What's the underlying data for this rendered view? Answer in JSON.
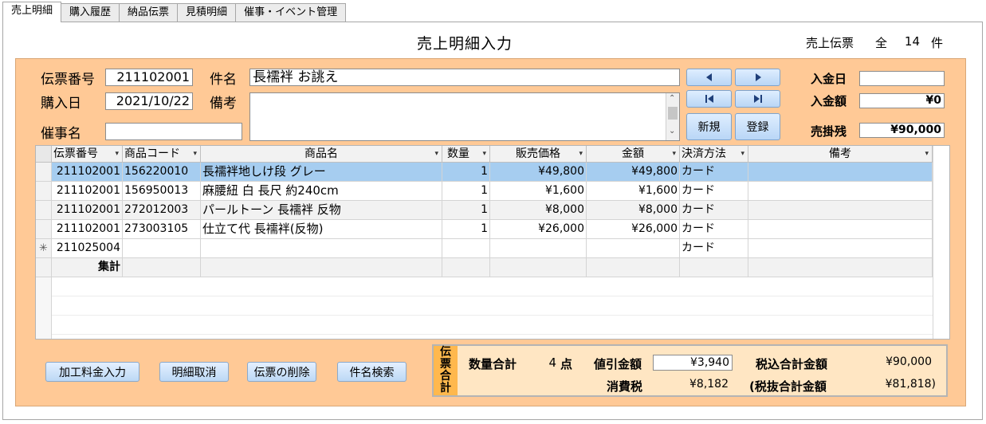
{
  "tabs": [
    "売上明細",
    "購入履歴",
    "納品伝票",
    "見積明細",
    "催事・イベント管理"
  ],
  "title": "売上明細入力",
  "header_total": {
    "label": "売上伝票",
    "scope": "全",
    "count": "14",
    "unit": "件"
  },
  "form": {
    "slip_no_label": "伝票番号",
    "slip_no": "211102001",
    "date_label": "購入日",
    "date": "2021/10/22",
    "event_label": "催事名",
    "event": "",
    "subject_label": "件名",
    "subject": "長襦袢 お誂え",
    "note_label": "備考",
    "note": ""
  },
  "buttons": {
    "new": "新規",
    "register": "登録"
  },
  "payment": {
    "pay_date_label": "入金日",
    "pay_date": "",
    "pay_amount_label": "入金額",
    "pay_amount": "¥0",
    "receivable_label": "売掛残",
    "receivable": "¥90,000"
  },
  "grid": {
    "columns": [
      "伝票番号",
      "商品コード",
      "商品名",
      "数量",
      "販売価格",
      "金額",
      "決済方法",
      "備考"
    ],
    "rows": [
      {
        "slip": "211102001",
        "code": "156220010",
        "name": "長襦袢地しけ段 グレー",
        "qty": "1",
        "price": "¥49,800",
        "amount": "¥49,800",
        "pay": "カード",
        "note": ""
      },
      {
        "slip": "211102001",
        "code": "156950013",
        "name": "麻腰紐 白 長尺 約240cm",
        "qty": "1",
        "price": "¥1,600",
        "amount": "¥1,600",
        "pay": "カード",
        "note": ""
      },
      {
        "slip": "211102001",
        "code": "272012003",
        "name": "パールトーン 長襦袢 反物",
        "qty": "1",
        "price": "¥8,000",
        "amount": "¥8,000",
        "pay": "カード",
        "note": ""
      },
      {
        "slip": "211102001",
        "code": "273003105",
        "name": "仕立て代 長襦袢(反物)",
        "qty": "1",
        "price": "¥26,000",
        "amount": "¥26,000",
        "pay": "カード",
        "note": ""
      }
    ],
    "new_row": {
      "marker": "✳",
      "slip": "211025004",
      "pay": "カード"
    },
    "total_label": "集計"
  },
  "actions": [
    "加工料金入力",
    "明細取消",
    "伝票の削除",
    "件名検索"
  ],
  "summary": {
    "side_label": "伝票合計",
    "qty_label": "数量合計",
    "qty": "4",
    "qty_unit": "点",
    "discount_label": "値引金額",
    "discount": "¥3,940",
    "tax_incl_label": "税込合計金額",
    "tax_incl": "¥90,000",
    "tax_label": "消費税",
    "tax": "¥8,182",
    "tax_excl_label": "(税抜合計金額",
    "tax_excl": "¥81,818)"
  },
  "colors": {
    "panel": "#ffc996",
    "selected_row": "#a6cdf0",
    "summary_bg": "#ffe6c3",
    "summary_side": "#ffb84d",
    "button": "#bcd8f5"
  }
}
